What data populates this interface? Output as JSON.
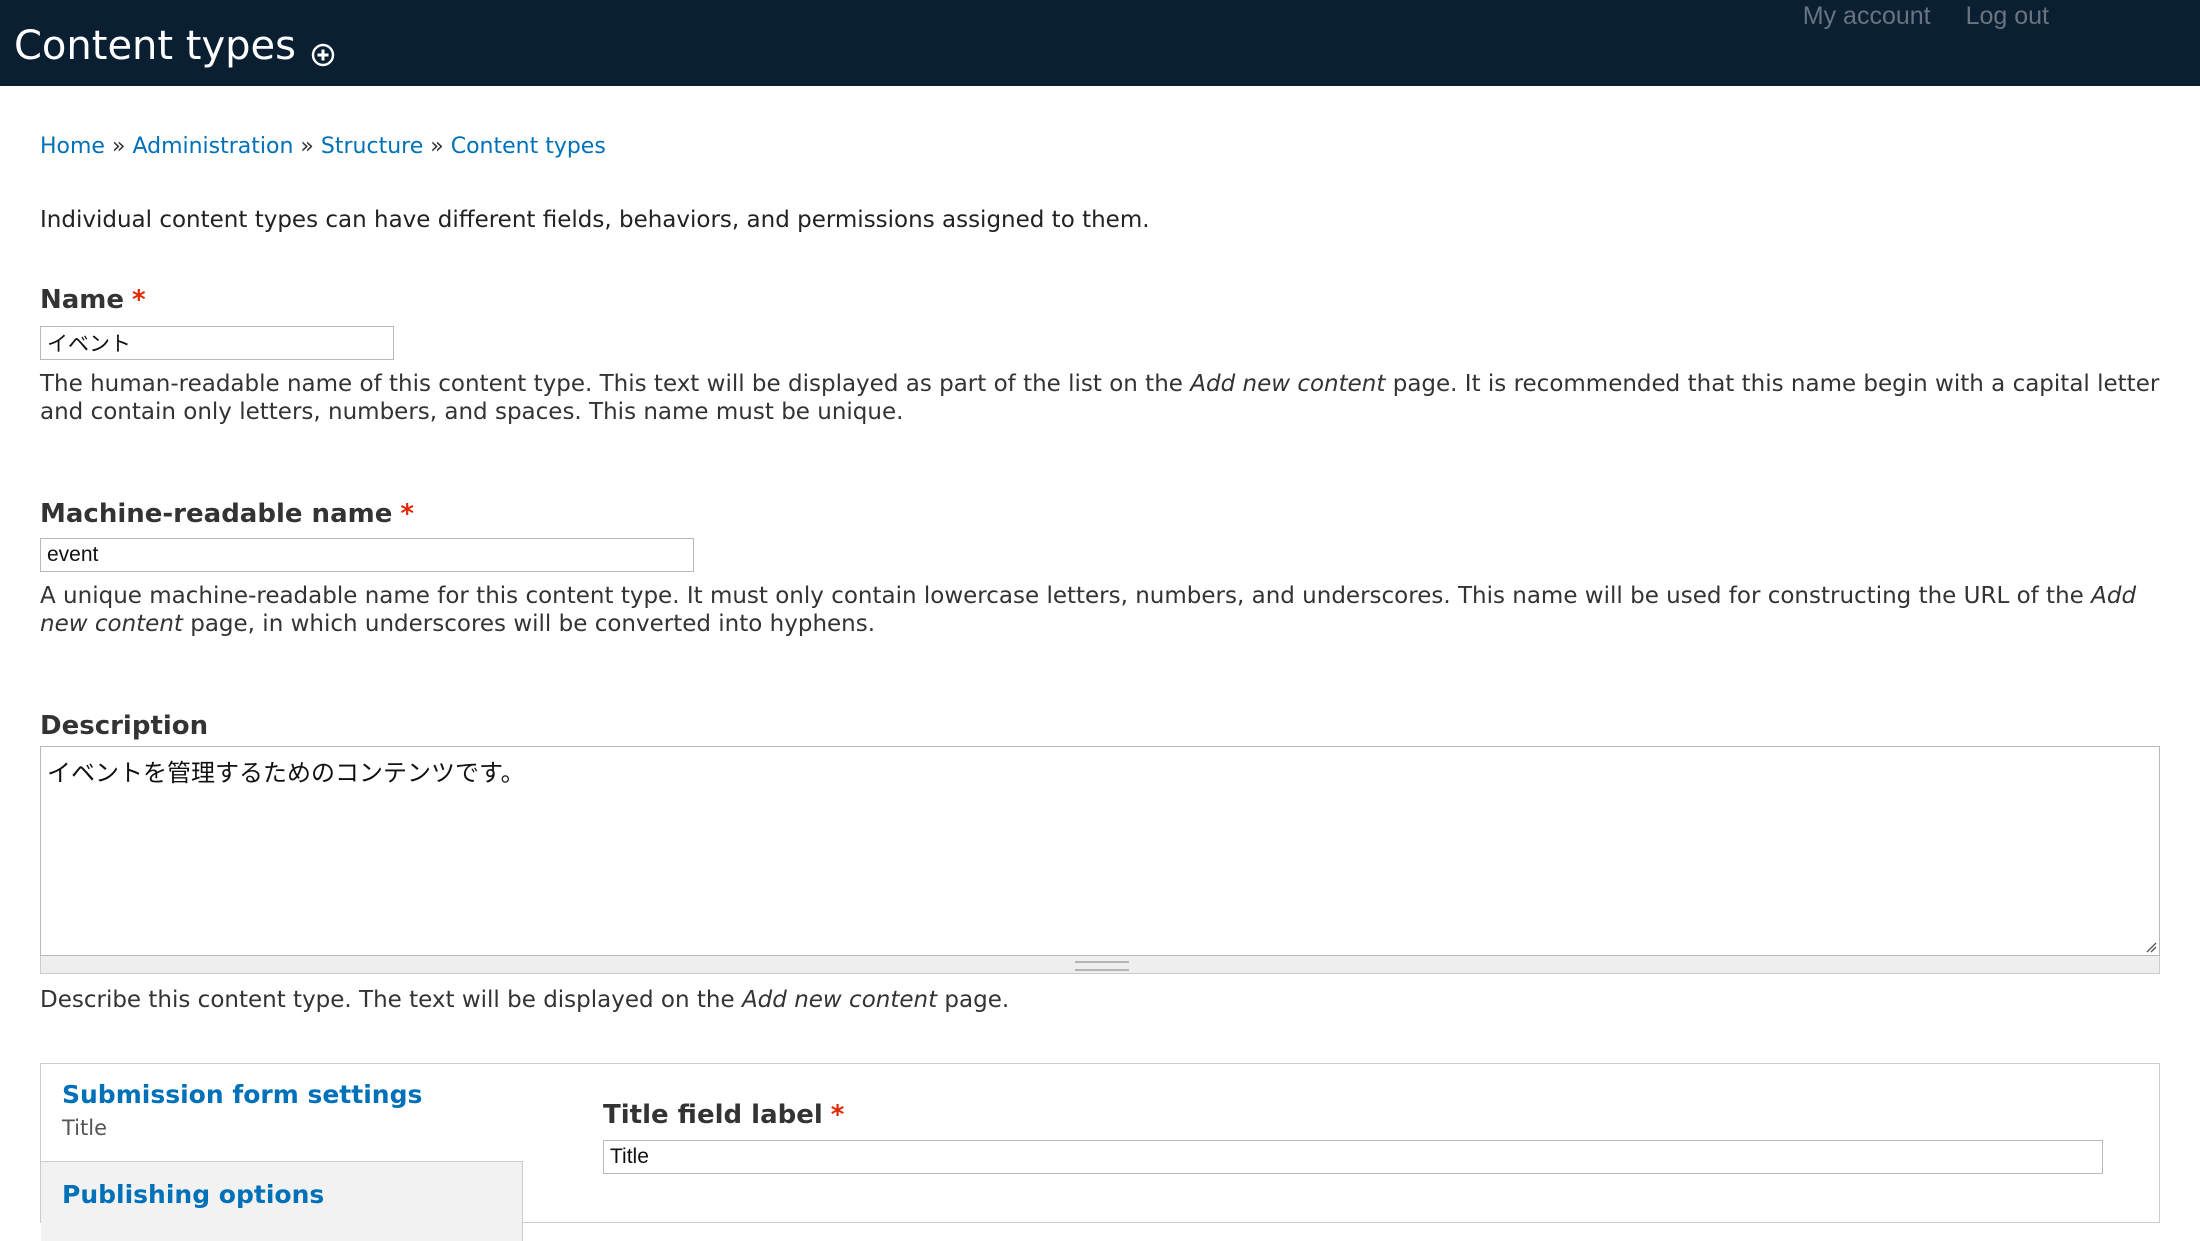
{
  "header": {
    "title": "Content types",
    "user_links": [
      "My account",
      "Log out"
    ],
    "colors": {
      "background": "#0b1f33",
      "title": "#ffffff",
      "links": "#6a7480"
    }
  },
  "breadcrumb": {
    "items": [
      "Home",
      "Administration",
      "Structure",
      "Content types"
    ],
    "separator": "»"
  },
  "help_text": "Individual content types can have different fields, behaviors, and permissions assigned to them.",
  "form": {
    "name": {
      "label": "Name",
      "required_marker": "*",
      "value": "イベント",
      "description_parts": [
        "The human-readable name of this content type. This text will be displayed as part of the list on the ",
        "Add new content",
        " page. It is recommended that this name begin with a capital letter and contain only letters, numbers, and spaces. This name must be unique."
      ]
    },
    "machine_name": {
      "label": "Machine-readable name",
      "required_marker": "*",
      "value": "event",
      "description_parts": [
        "A unique machine-readable name for this content type. It must only contain lowercase letters, numbers, and underscores. This name will be used for constructing the URL of the ",
        "Add new content",
        " page, in which underscores will be converted into hyphens."
      ]
    },
    "description": {
      "label": "Description",
      "value": "イベントを管理するためのコンテンツです。",
      "description_parts": [
        "Describe this content type. The text will be displayed on the ",
        "Add new content",
        " page."
      ]
    }
  },
  "vertical_tabs": {
    "tabs": [
      {
        "title": "Submission form settings",
        "summary": "Title",
        "active": true
      },
      {
        "title": "Publishing options",
        "summary": "",
        "active": false
      }
    ],
    "pane": {
      "title_label": {
        "label": "Title field label",
        "required_marker": "*",
        "value": "Title"
      }
    }
  },
  "colors": {
    "link": "#0071b8",
    "required": "#e32700"
  }
}
